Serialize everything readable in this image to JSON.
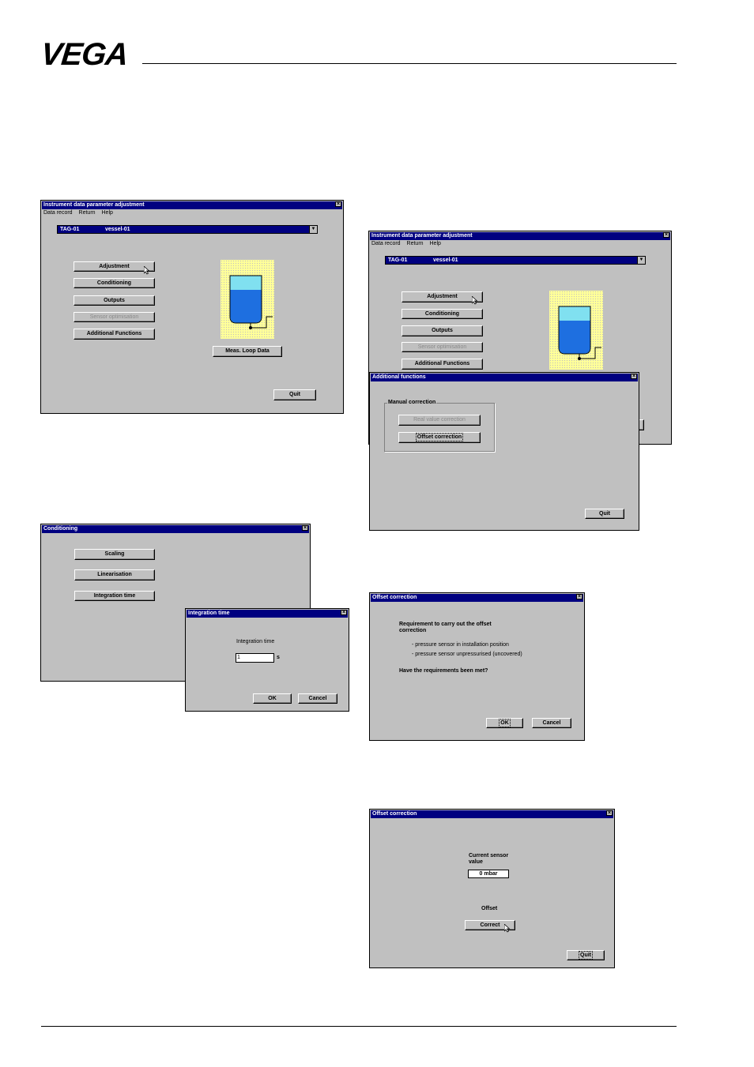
{
  "logo": "VEGA",
  "win1": {
    "title": "Instrument data parameter adjustment",
    "menu": [
      "Data record",
      "Return",
      "Help"
    ],
    "tag": "TAG-01",
    "vessel": "vessel-01",
    "buttons": [
      "Adjustment",
      "Conditioning",
      "Outputs",
      "Sensor optimisation",
      "Additional Functions"
    ],
    "meas_loop": "Meas. Loop Data",
    "quit": "Quit"
  },
  "win2": {
    "title": "Instrument data parameter adjustment",
    "menu": [
      "Data record",
      "Return",
      "Help"
    ],
    "tag": "TAG-01",
    "vessel": "vessel-01",
    "buttons": [
      "Adjustment",
      "Conditioning",
      "Outputs",
      "Sensor optimisation",
      "Additional Functions"
    ]
  },
  "additional": {
    "title": "Additional functions",
    "group": "Manual correction",
    "real_value": "Real value correction",
    "offset": "Offset correction",
    "quit": "Quit"
  },
  "conditioning": {
    "title": "Conditioning",
    "buttons": [
      "Scaling",
      "Linearisation",
      "Integration time"
    ]
  },
  "integration": {
    "title": "Integration time",
    "label": "Integration time",
    "value": "1",
    "unit": "s",
    "ok": "OK",
    "cancel": "Cancel"
  },
  "offset1": {
    "title": "Offset correction",
    "req1": "Requirement to carry out the offset",
    "req2": "correction",
    "item1": "- pressure sensor in installation position",
    "item2": "- pressure sensor unpressurised (uncovered)",
    "question": "Have the requirements been met?",
    "ok": "OK",
    "cancel": "Cancel"
  },
  "offset2": {
    "title": "Offset correction",
    "current1": "Current sensor",
    "current2": "value",
    "sensor_value": "0 mbar",
    "offset_label": "Offset",
    "correct": "Correct",
    "quit": "Quit"
  },
  "colors": {
    "titlebar": "#000080",
    "window": "#c0c0c0",
    "tank_bg": "#ffff99",
    "liquid": "#1e6fe0",
    "empty": "#80e0f0"
  }
}
